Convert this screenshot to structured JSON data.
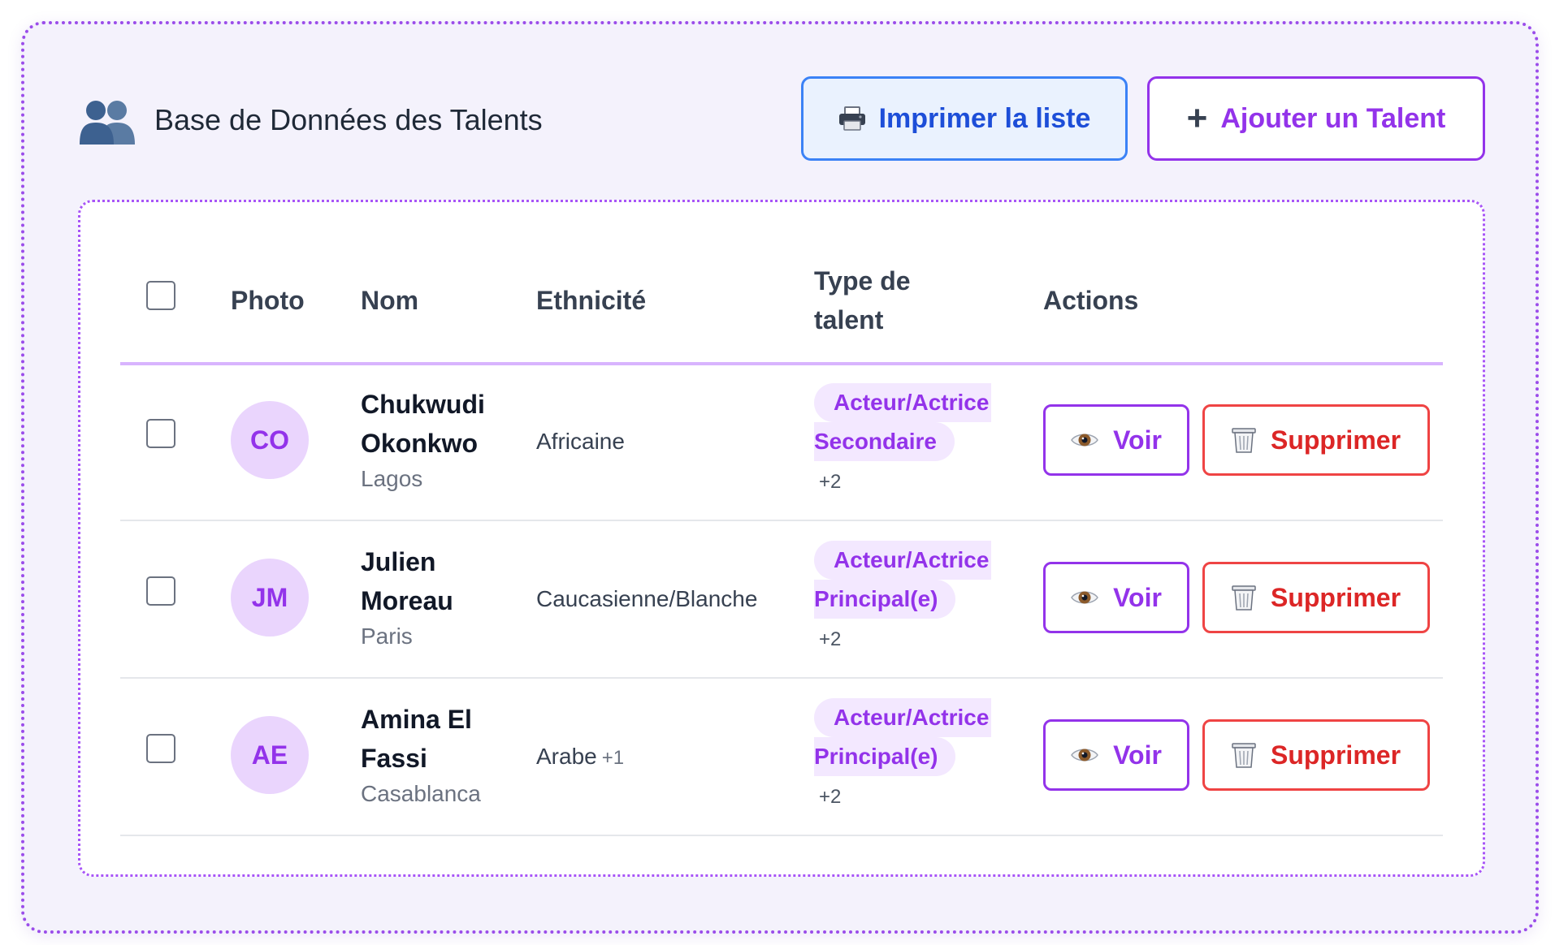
{
  "header": {
    "title": "Base de Données des Talents",
    "icon": "users-icon",
    "print_label": "Imprimer la liste",
    "add_label": "Ajouter un Talent"
  },
  "table": {
    "columns": {
      "photo": "Photo",
      "name": "Nom",
      "ethnicity": "Ethnicité",
      "type_line1": "Type de",
      "type_line2": "talent",
      "actions": "Actions"
    },
    "rows": [
      {
        "initials": "CO",
        "name_line1": "Chukwudi",
        "name_line2": "Okonkwo",
        "city": "Lagos",
        "ethnicity": "Africaine",
        "ethnicity_extra": "",
        "tag_line1": "Acteur/Actrice",
        "tag_line2": "Secondaire",
        "more": "+2",
        "view_label": "Voir",
        "delete_label": "Supprimer"
      },
      {
        "initials": "JM",
        "name_line1": "Julien",
        "name_line2": "Moreau",
        "city": "Paris",
        "ethnicity": "Caucasienne/Blanche",
        "ethnicity_extra": "",
        "tag_line1": "Acteur/Actrice",
        "tag_line2": "Principal(e)",
        "more": "+2",
        "view_label": "Voir",
        "delete_label": "Supprimer"
      },
      {
        "initials": "AE",
        "name_line1": "Amina El",
        "name_line2": "Fassi",
        "city": "Casablanca",
        "ethnicity": "Arabe",
        "ethnicity_extra": "+1",
        "tag_line1": "Acteur/Actrice",
        "tag_line2": "Principal(e)",
        "more": "+2",
        "view_label": "Voir",
        "delete_label": "Supprimer"
      }
    ]
  },
  "colors": {
    "accent": "#9333ea",
    "print_blue": "#1d4ed8",
    "danger": "#dc2626",
    "avatar_bg": "#ead5fd",
    "tag_bg": "#f3e8ff"
  },
  "icons": {
    "print": "printer-icon",
    "add": "plus-icon",
    "view": "eye-icon",
    "delete": "trash-icon"
  }
}
